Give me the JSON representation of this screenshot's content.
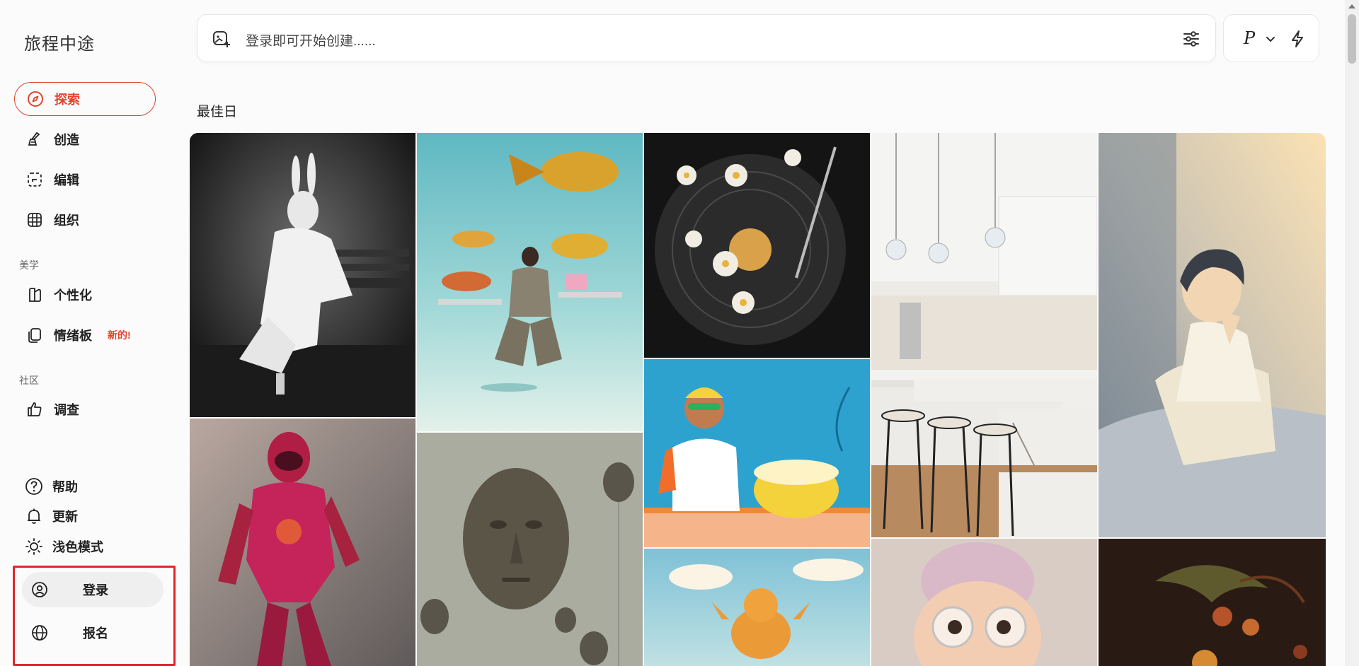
{
  "app": {
    "brand": "旅程中途"
  },
  "sidebar": {
    "items": [
      {
        "label": "探索",
        "icon": "compass-icon"
      },
      {
        "label": "创造",
        "icon": "brush-icon"
      },
      {
        "label": "编辑",
        "icon": "edit-select-icon"
      },
      {
        "label": "组织",
        "icon": "grid-icon"
      }
    ],
    "sections": {
      "aesthetics": "美学",
      "community": "社区"
    },
    "aesthetics_items": [
      {
        "label": "个性化",
        "icon": "personalize-icon"
      },
      {
        "label": "情绪板",
        "icon": "moodboard-icon",
        "badge": "新的!"
      }
    ],
    "community_items": [
      {
        "label": "调查",
        "icon": "thumbs-up-icon"
      }
    ],
    "bottom": {
      "help": "帮助",
      "updates": "更新",
      "theme": "浅色模式"
    },
    "auth": {
      "login": "登录",
      "signup": "报名"
    }
  },
  "topbar": {
    "placeholder": "登录即可开始创建......",
    "mode_letter": "P"
  },
  "main": {
    "heading": "最佳日"
  },
  "gallery": {
    "images": [
      {
        "name": "rabbit-man-bench"
      },
      {
        "name": "underwater-woman-fish"
      },
      {
        "name": "vinyl-record-flowers"
      },
      {
        "name": "white-kitchen"
      },
      {
        "name": "sleeping-boy-illustration"
      },
      {
        "name": "red-robot-suit"
      },
      {
        "name": "floating-heads"
      },
      {
        "name": "dj-illustration"
      },
      {
        "name": "jumping-cat"
      },
      {
        "name": "boy-with-glasses-3d"
      },
      {
        "name": "dark-fruit-still-life"
      }
    ]
  },
  "colors": {
    "accent": "#e0452e",
    "highlight_box": "#e3242b"
  }
}
